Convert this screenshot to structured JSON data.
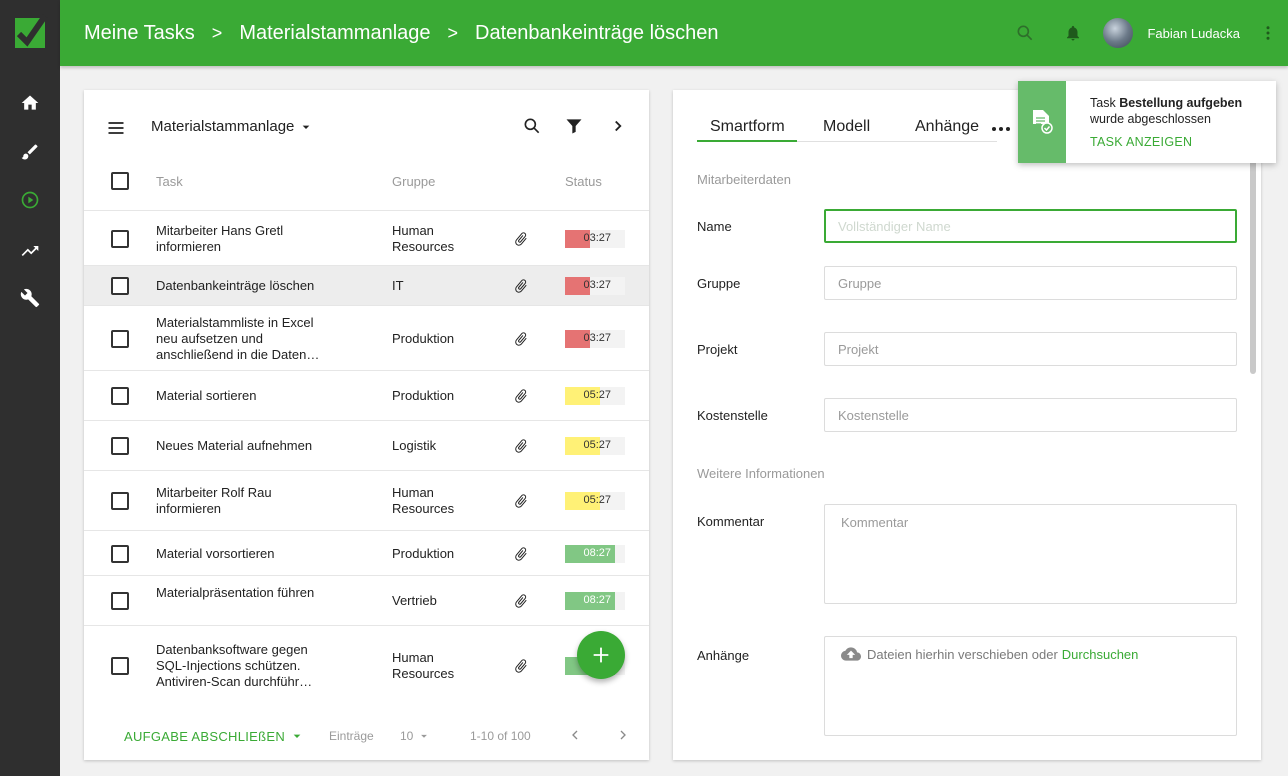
{
  "header": {
    "crumbs": [
      "Meine Tasks",
      "Materialstammanlage",
      "Datenbankeinträge löschen"
    ],
    "separator": ">",
    "user_name": "Fabian Ludacka"
  },
  "sidebar": {
    "items": [
      {
        "name": "home-icon"
      },
      {
        "name": "brush-icon"
      },
      {
        "name": "play-circle-icon"
      },
      {
        "name": "trending-icon"
      },
      {
        "name": "wrench-icon"
      }
    ]
  },
  "list": {
    "title": "Materialstammanlage",
    "columns": {
      "task": "Task",
      "group": "Gruppe",
      "status": "Status"
    },
    "rows": [
      {
        "task": "Mitarbeiter Hans Gretl informieren",
        "group": "Human Resources",
        "time": "03:27",
        "color": "#e57373",
        "fill": 0.42
      },
      {
        "task": "Datenbankeinträge löschen",
        "group": "IT",
        "time": "03:27",
        "color": "#e57373",
        "fill": 0.42
      },
      {
        "task": "Materialstammliste in Excel neu aufsetzen und anschließend in die Daten…",
        "group": "Produktion",
        "time": "03:27",
        "color": "#e57373",
        "fill": 0.42
      },
      {
        "task": "Material sortieren",
        "group": "Produktion",
        "time": "05:27",
        "color": "#fff176",
        "fill": 0.58
      },
      {
        "task": "Neues Material aufnehmen",
        "group": "Logistik",
        "time": "05:27",
        "color": "#fff176",
        "fill": 0.58
      },
      {
        "task": "Mitarbeiter Rolf Rau informieren",
        "group": "Human Resources",
        "time": "05:27",
        "color": "#fff176",
        "fill": 0.58
      },
      {
        "task": "Material vorsortieren",
        "group": "Produktion",
        "time": "08:27",
        "color": "#81c784",
        "fill": 0.83
      },
      {
        "task": "Materialpräsentation führen",
        "group": "Vertrieb",
        "time": "08:27",
        "color": "#81c784",
        "fill": 0.83
      },
      {
        "task": "Datenbanksoftware gegen SQL-Injections schützen. Antiviren-Scan durchführ…",
        "group": "Human Resources",
        "time": "08:27",
        "color": "#81c784",
        "fill": 0.83
      }
    ],
    "footer": {
      "action": "AUFGABE ABSCHLIEßEN",
      "entries_label": "Einträge",
      "per_page": "10",
      "range": "1-10 of 100"
    }
  },
  "form": {
    "tabs": [
      "Smartform",
      "Modell",
      "Anhänge"
    ],
    "section1": "Mitarbeiterdaten",
    "section2": "Weitere Informationen",
    "fields": {
      "name": {
        "label": "Name",
        "placeholder": "Vollständiger Name"
      },
      "gruppe": {
        "label": "Gruppe",
        "placeholder": "Gruppe"
      },
      "projekt": {
        "label": "Projekt",
        "placeholder": "Projekt"
      },
      "kostenstelle": {
        "label": "Kostenstelle",
        "placeholder": "Kostenstelle"
      },
      "kommentar": {
        "label": "Kommentar",
        "placeholder": "Kommentar"
      },
      "anhaenge": {
        "label": "Anhänge",
        "drop_text": "Dateien hierhin verschieben oder",
        "browse": "Durchsuchen"
      }
    }
  },
  "toast": {
    "prefix": "Task",
    "bold": "Bestellung aufgeben",
    "suffix": "wurde abgeschlossen",
    "action": "TASK ANZEIGEN"
  },
  "colors": {
    "accent": "#3aaa35",
    "sidebar": "#2f2f2f"
  }
}
